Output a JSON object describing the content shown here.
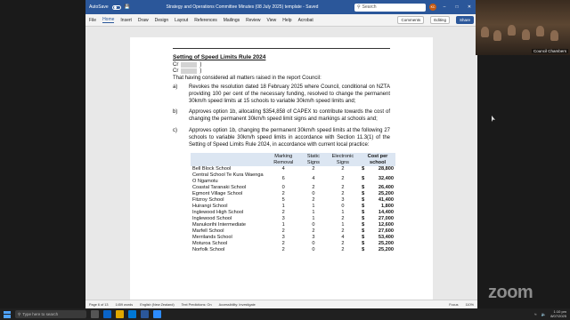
{
  "window": {
    "autosave": "AutoSave",
    "title": "Strategy and Operations Committee Minutes (08 July 2025) template - Saved",
    "search_placeholder": "Search",
    "avatar_initials": "KC"
  },
  "ribbon": {
    "tabs": [
      "File",
      "Home",
      "Insert",
      "Draw",
      "Design",
      "Layout",
      "References",
      "Mailings",
      "Review",
      "View",
      "Help",
      "Acrobat"
    ],
    "active_tab": "Home",
    "comments": "Comments",
    "editing": "Editing",
    "share": "Share"
  },
  "document": {
    "heading": "Setting of Speed Limits Rule 2024",
    "movers": [
      "Cr",
      "Cr"
    ],
    "intro": "That having considered all matters raised in the report Council:",
    "items": [
      {
        "label": "a)",
        "text": "Revokes the resolution dated 18 February 2025 where Council, conditional on NZTA providing 100 per cent of the necessary funding, resolved to change the permanent 30km/h speed limits at 15 schools to variable 30km/h speed limits and;"
      },
      {
        "label": "b)",
        "text": "Approves option 1b, allocating $354,858 of CAPEX to contribute towards the cost of changing the permanent 30km/h speed limit signs and markings at schools and;"
      },
      {
        "label": "c)",
        "text": "Approves option 1b, changing the permanent 30km/h speed limits at the following 27 schools to variable 30km/h speed limits in accordance with Section 11.3(1) of the Setting of Speed Limits Rule 2024, in accordance with current local practice:"
      }
    ],
    "table": {
      "headers": [
        "",
        "Marking Removal",
        "Static Signs",
        "Electronic Signs",
        "Cost per school"
      ],
      "rows": [
        {
          "school": "Bell Block School",
          "marking": "4",
          "static": "2",
          "electronic": "2",
          "dollar": "$",
          "cost": "28,800"
        },
        {
          "school": "Central School Te Kura Waenga O Ngamotu",
          "marking": "6",
          "static": "4",
          "electronic": "2",
          "dollar": "$",
          "cost": "32,400"
        },
        {
          "school": "Coastal Taranaki School",
          "marking": "0",
          "static": "2",
          "electronic": "2",
          "dollar": "$",
          "cost": "26,400"
        },
        {
          "school": "Egmont Village School",
          "marking": "2",
          "static": "0",
          "electronic": "2",
          "dollar": "$",
          "cost": "25,200"
        },
        {
          "school": "Fitzroy School",
          "marking": "5",
          "static": "2",
          "electronic": "3",
          "dollar": "$",
          "cost": "41,400"
        },
        {
          "school": "Huirangi School",
          "marking": "1",
          "static": "1",
          "electronic": "0",
          "dollar": "$",
          "cost": "1,800"
        },
        {
          "school": "Inglewood High School",
          "marking": "2",
          "static": "1",
          "electronic": "1",
          "dollar": "$",
          "cost": "14,400"
        },
        {
          "school": "Inglewood School",
          "marking": "3",
          "static": "1",
          "electronic": "2",
          "dollar": "$",
          "cost": "27,000"
        },
        {
          "school": "Manukorihi Intermediate",
          "marking": "1",
          "static": "0",
          "electronic": "1",
          "dollar": "$",
          "cost": "12,600"
        },
        {
          "school": "Marfell School",
          "marking": "2",
          "static": "2",
          "electronic": "2",
          "dollar": "$",
          "cost": "27,600"
        },
        {
          "school": "Merrilands School",
          "marking": "3",
          "static": "3",
          "electronic": "4",
          "dollar": "$",
          "cost": "53,400"
        },
        {
          "school": "Moturoa School",
          "marking": "2",
          "static": "0",
          "electronic": "2",
          "dollar": "$",
          "cost": "25,200"
        },
        {
          "school": "Norfolk School",
          "marking": "2",
          "static": "0",
          "electronic": "2",
          "dollar": "$",
          "cost": "25,200"
        }
      ]
    }
  },
  "statusbar": {
    "page": "Page 6 of 13",
    "words": "1459 words",
    "language": "English (New Zealand)",
    "predictions": "Text Predictions: On",
    "accessibility": "Accessibility: Investigate",
    "focus": "Focus",
    "zoom": "110%"
  },
  "camera": {
    "label": "Council Chambers"
  },
  "zoom_logo": "zoom",
  "taskbar": {
    "search_placeholder": "Type here to search",
    "time": "1:10 pm",
    "date": "8/07/2025"
  },
  "colors": {
    "word_blue": "#2b579a",
    "table_header": "#dce6f2"
  }
}
